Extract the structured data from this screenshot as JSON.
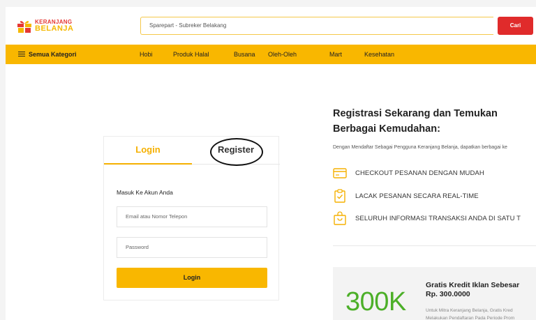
{
  "header": {
    "logo_line1": "KERANJANG",
    "logo_line2": "BELANJA",
    "search_value": "Sparepart - Subreker Belakang",
    "search_button": "Cari"
  },
  "nav": {
    "category_label": "Semua Kategori",
    "links": [
      "Hobi",
      "Produk Halal",
      "Busana",
      "Oleh-Oleh",
      "Mart",
      "Kesehatan"
    ]
  },
  "login_card": {
    "tab_login": "Login",
    "tab_register": "Register",
    "subtitle": "Masuk Ke Akun Anda",
    "email_placeholder": "Email atau Nomor Telepon",
    "password_placeholder": "Password",
    "login_button": "Login"
  },
  "registration": {
    "title": "Registrasi Sekarang dan Temukan Berbagai Kemudahan:",
    "description": "Dengan Mendaftar Sebagai Pengguna Keranjang Belanja, dapatkan berbagai ke",
    "features": [
      {
        "icon": "credit-card-icon",
        "text": "CHECKOUT PESANAN DENGAN MUDAH"
      },
      {
        "icon": "clipboard-check-icon",
        "text": "LACAK PESANAN SECARA REAL-TIME"
      },
      {
        "icon": "shopping-bag-icon",
        "text": "SELURUH INFORMASI TRANSAKSI ANDA DI SATU T"
      }
    ]
  },
  "promo": {
    "big_text": "300K",
    "title_line1": "Gratis Kredit Iklan Sebesar",
    "title_line2": "Rp. 300.0000",
    "text_line1": "Untuk Mitra Keranjang Belanja, Gratis Kred",
    "text_line2": "Melakukan Pendaftaran Pada Periode Prom"
  },
  "colors": {
    "brand_yellow": "#f9b700",
    "brand_red": "#e02b2b",
    "promo_green": "#4caf28"
  }
}
